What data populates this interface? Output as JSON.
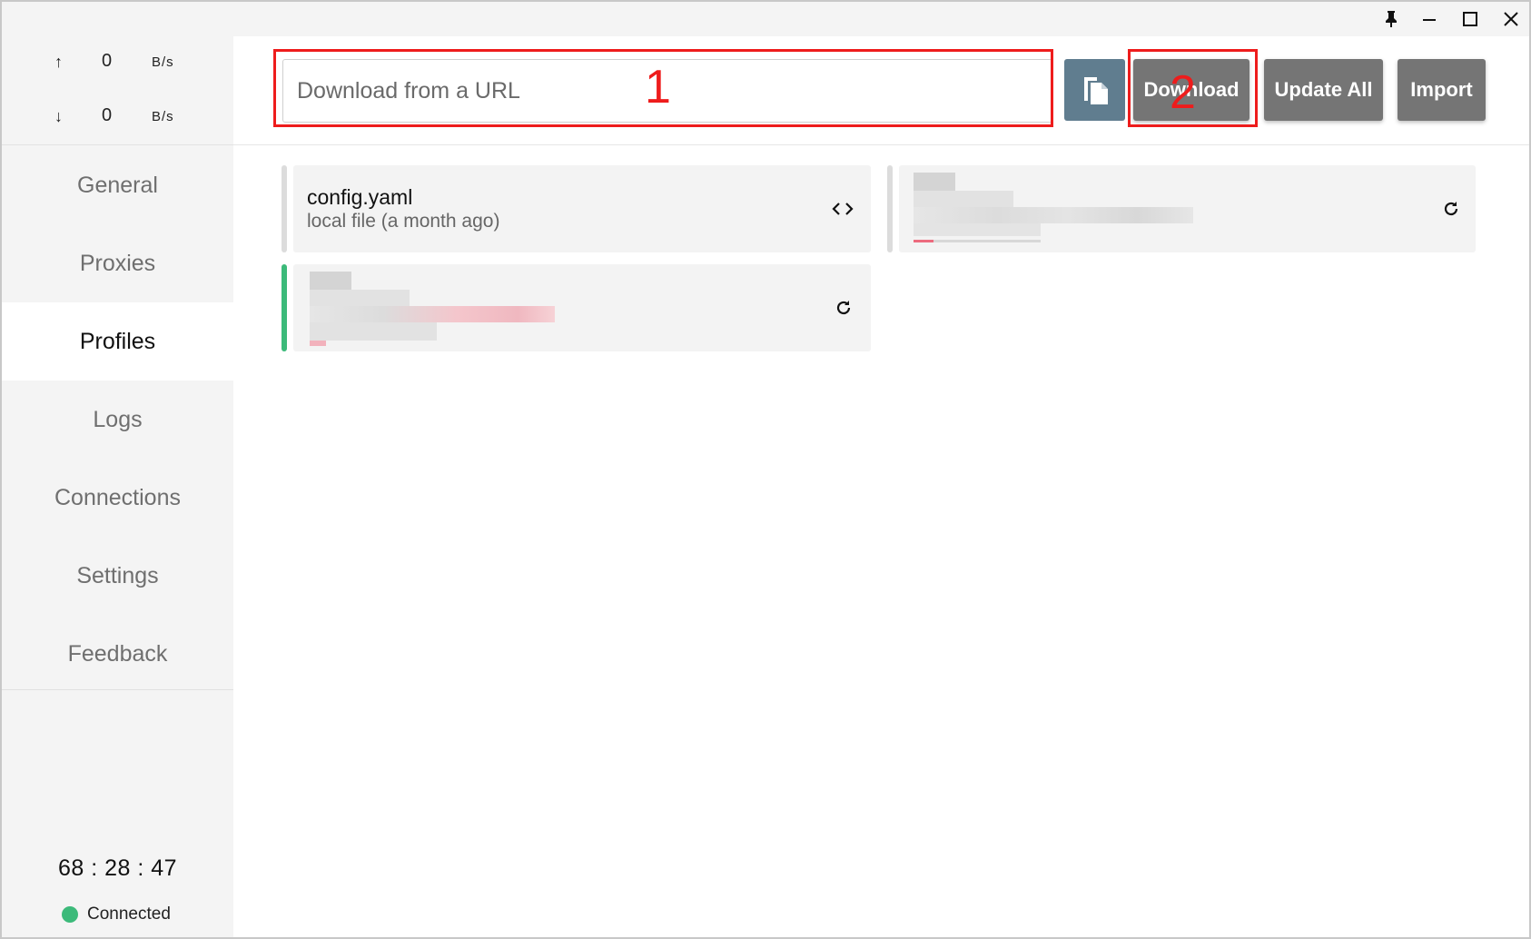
{
  "window": {
    "pin_icon": "pin-icon",
    "minimize_icon": "minimize-icon",
    "maximize_icon": "maximize-icon",
    "close_icon": "close-icon"
  },
  "traffic": {
    "up": {
      "arrow": "↑",
      "value": "0",
      "unit": "B/s"
    },
    "down": {
      "arrow": "↓",
      "value": "0",
      "unit": "B/s"
    }
  },
  "nav": {
    "items": [
      {
        "label": "General"
      },
      {
        "label": "Proxies"
      },
      {
        "label": "Profiles"
      },
      {
        "label": "Logs"
      },
      {
        "label": "Connections"
      },
      {
        "label": "Settings"
      },
      {
        "label": "Feedback"
      }
    ],
    "active": "Profiles"
  },
  "footer": {
    "timer": "68 : 28 : 47",
    "status": "Connected",
    "status_color": "#3cba7a"
  },
  "toolbar": {
    "url_placeholder": "Download from a URL",
    "paste_icon": "paste-icon",
    "download_label": "Download",
    "update_all_label": "Update All",
    "import_label": "Import"
  },
  "annotations": {
    "box1_label": "1",
    "box2_label": "2",
    "color": "#ee1c1c"
  },
  "profiles": [
    {
      "title": "config.yaml",
      "subtitle": "local file (a month ago)",
      "icon": "code-icon",
      "selected": false
    },
    {
      "title": "",
      "subtitle": "",
      "icon": "refresh-icon",
      "selected": false,
      "blurred": true
    },
    {
      "title": "",
      "subtitle": "",
      "icon": "refresh-icon",
      "selected": true,
      "blurred": true
    }
  ],
  "colors": {
    "accent_selected": "#3cba7a",
    "button_gray": "#757575",
    "paste_button": "#607d8f"
  }
}
